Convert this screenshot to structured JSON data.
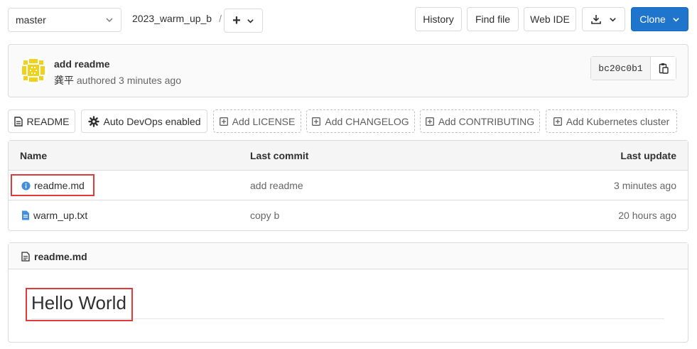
{
  "toolbar": {
    "branch": "master",
    "repo_path": "2023_warm_up_b",
    "path_separator": "/",
    "add_button_symbol": "+",
    "history_label": "History",
    "find_file_label": "Find file",
    "web_ide_label": "Web IDE",
    "clone_label": "Clone"
  },
  "commit": {
    "message": "add readme",
    "author": "龚平",
    "authored_text": "authored 3 minutes ago",
    "sha": "bc20c0b1"
  },
  "quick_actions": [
    {
      "label": "README"
    },
    {
      "label": "Auto DevOps enabled"
    },
    {
      "label": "Add LICENSE"
    },
    {
      "label": "Add CHANGELOG"
    },
    {
      "label": "Add CONTRIBUTING"
    },
    {
      "label": "Add Kubernetes cluster"
    }
  ],
  "file_table": {
    "headers": {
      "name": "Name",
      "last_commit": "Last commit",
      "last_update": "Last update"
    },
    "rows": [
      {
        "name": "readme.md",
        "commit": "add readme",
        "updated": "3 minutes ago",
        "icon": "info-icon"
      },
      {
        "name": "warm_up.txt",
        "commit": "copy b",
        "updated": "20 hours ago",
        "icon": "file-icon"
      }
    ]
  },
  "readme": {
    "filename": "readme.md",
    "heading": "Hello World"
  },
  "colors": {
    "primary": "#1f75cb",
    "highlight_box": "#e03a3a",
    "info_icon": "#428fdc",
    "avatar": "#f1d21b"
  }
}
